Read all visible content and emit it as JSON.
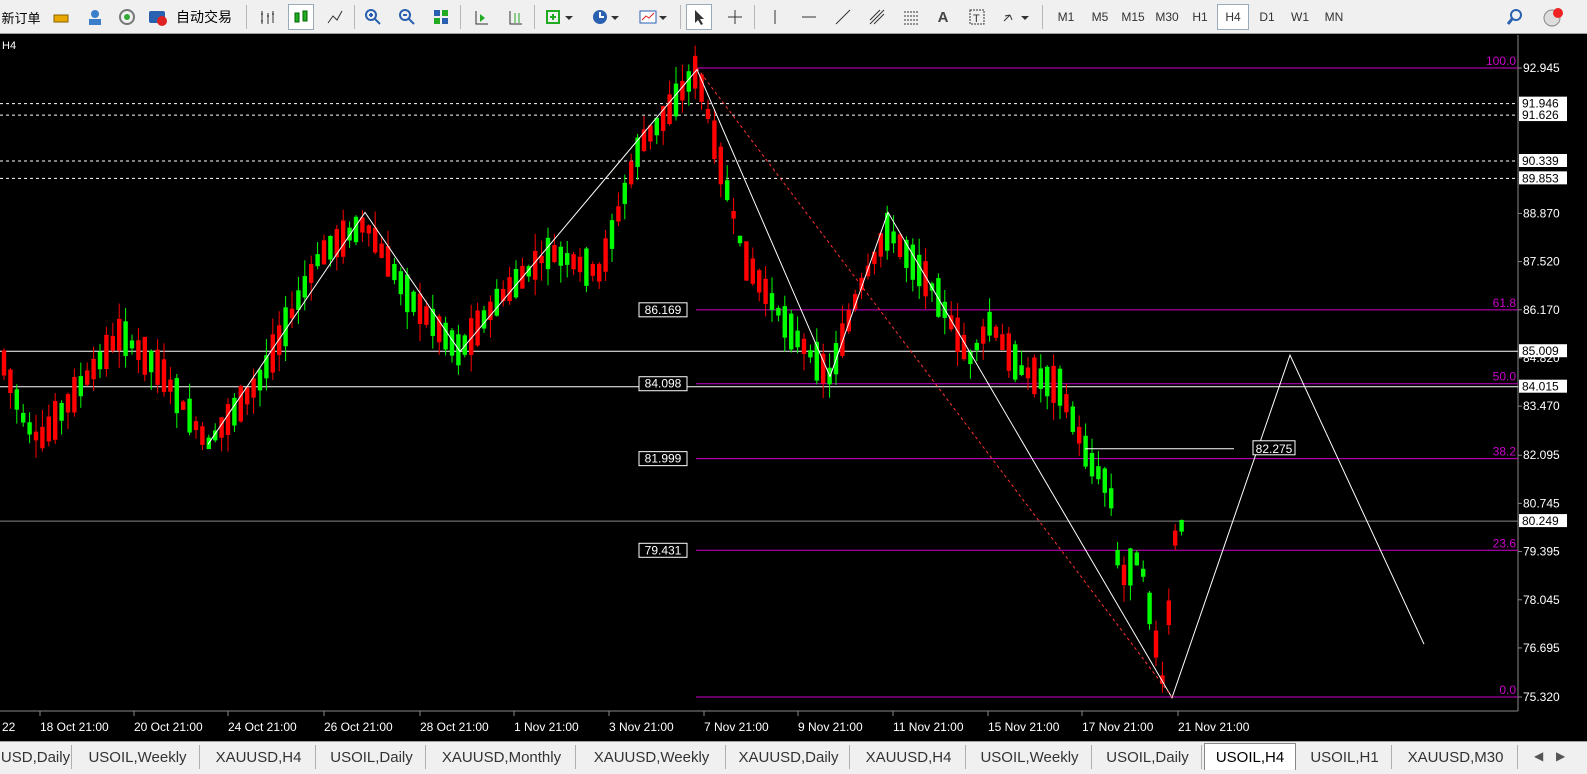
{
  "toolbar": {
    "new_order": "新订单",
    "auto_trade": "自动交易",
    "timeframes": [
      "M1",
      "M5",
      "M15",
      "M30",
      "H1",
      "H4",
      "D1",
      "W1",
      "MN"
    ],
    "active_timeframe": "H4"
  },
  "chart": {
    "period_label": "H4",
    "price_ticks": [
      "92.945",
      "86.170",
      "84.820",
      "83.470",
      "82.095",
      "80.745",
      "79.395",
      "78.045",
      "76.695",
      "75.320",
      "88.870",
      "87.520"
    ],
    "level_labels": [
      "91.946",
      "91.626",
      "90.339",
      "89.853",
      "85.009",
      "84.015",
      "80.249"
    ],
    "fib_levels": [
      "100.0",
      "61.8",
      "50.0",
      "38.2",
      "23.6",
      "0.0"
    ],
    "fib_price_labels": [
      "86.169",
      "84.098",
      "81.999",
      "79.431"
    ],
    "trendline_label": "82.275",
    "date_labels": [
      "18 Oct 21:00",
      "20 Oct 21:00",
      "24 Oct 21:00",
      "26 Oct 21:00",
      "28 Oct 21:00",
      "1 Nov 21:00",
      "3 Nov 21:00",
      "7 Nov 21:00",
      "9 Nov 21:00",
      "11 Nov 21:00",
      "15 Nov 21:00",
      "17 Nov 21:00",
      "21 Nov 21:00"
    ],
    "date_prefix": "22",
    "colors": {
      "up": "#00ff00",
      "down": "#ff0000",
      "fib": "#cc00cc",
      "zigzag": "#ffffff"
    }
  },
  "tabs": [
    "USD,Daily",
    "USOIL,Weekly",
    "XAUUSD,H4",
    "USOIL,Daily",
    "XAUUSD,Monthly",
    "XAUUSD,Weekly",
    "XAUUSD,Daily",
    "XAUUSD,H4",
    "USOIL,Weekly",
    "USOIL,Daily",
    "USOIL,H4",
    "USOIL,H1",
    "XAUUSD,M30"
  ],
  "active_tab": "USOIL,H4"
}
